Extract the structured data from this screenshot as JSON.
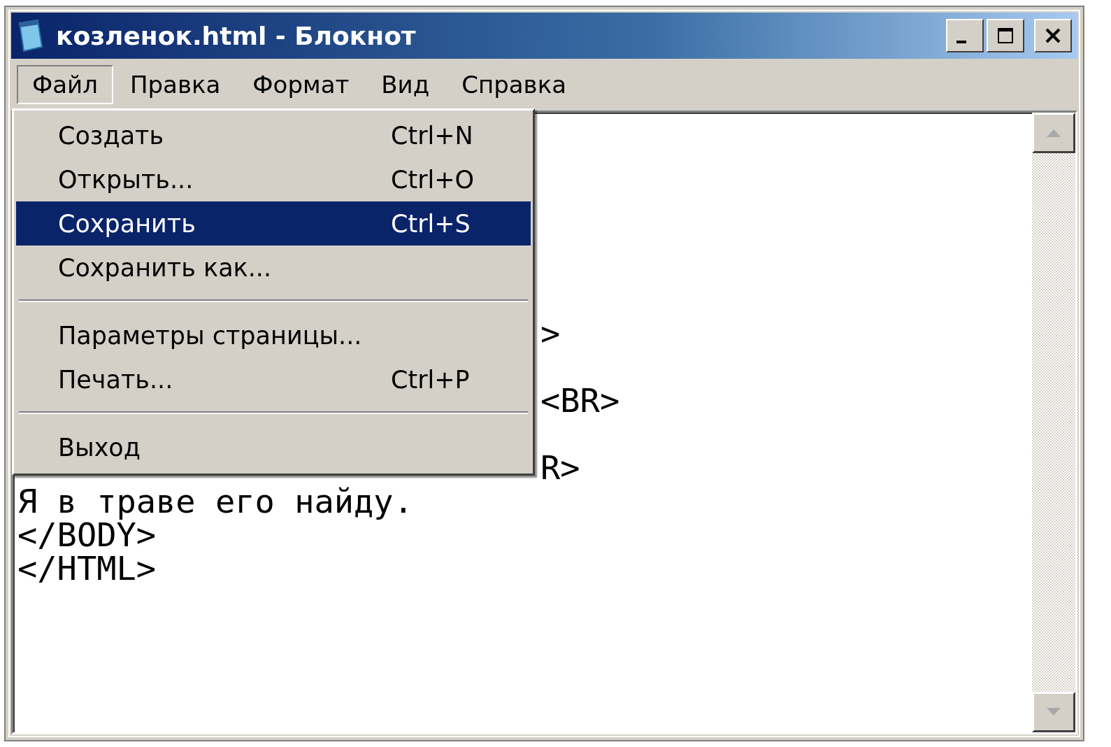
{
  "window": {
    "title": "козленок.html - Блокнот"
  },
  "menubar": [
    {
      "label": "Файл",
      "selected": true
    },
    {
      "label": "Правка",
      "selected": false
    },
    {
      "label": "Формат",
      "selected": false
    },
    {
      "label": "Вид",
      "selected": false
    },
    {
      "label": "Справка",
      "selected": false
    }
  ],
  "menu": {
    "items": [
      {
        "kind": "item",
        "label": "Создать",
        "shortcut": "Ctrl+N",
        "selected": false
      },
      {
        "kind": "item",
        "label": "Открыть...",
        "shortcut": "Ctrl+O",
        "selected": false
      },
      {
        "kind": "item",
        "label": "Сохранить",
        "shortcut": "Ctrl+S",
        "selected": true
      },
      {
        "kind": "item",
        "label": "Сохранить как...",
        "selected": false
      },
      {
        "kind": "separator"
      },
      {
        "kind": "item",
        "label": "Параметры страницы...",
        "selected": false
      },
      {
        "kind": "item",
        "label": "Печать...",
        "shortcut": "Ctrl+P",
        "selected": false
      },
      {
        "kind": "separator"
      },
      {
        "kind": "item",
        "label": "Выход",
        "selected": false
      }
    ]
  },
  "editor": {
    "lines": [
      {
        "kind": "hidden"
      },
      {
        "kind": "hidden"
      },
      {
        "kind": "hidden"
      },
      {
        "kind": "hidden"
      },
      {
        "kind": "hidden"
      },
      {
        "kind": "hidden"
      },
      {
        "kind": "partial",
        "text": ">"
      },
      {
        "kind": "hidden"
      },
      {
        "kind": "partial",
        "text": "<BR>"
      },
      {
        "kind": "hidden"
      },
      {
        "kind": "partial",
        "text": "R>"
      },
      {
        "kind": "full",
        "text": "Я в траве его найду."
      },
      {
        "kind": "full",
        "text": "</BODY>"
      },
      {
        "kind": "full",
        "text": "</HTML>"
      }
    ]
  }
}
